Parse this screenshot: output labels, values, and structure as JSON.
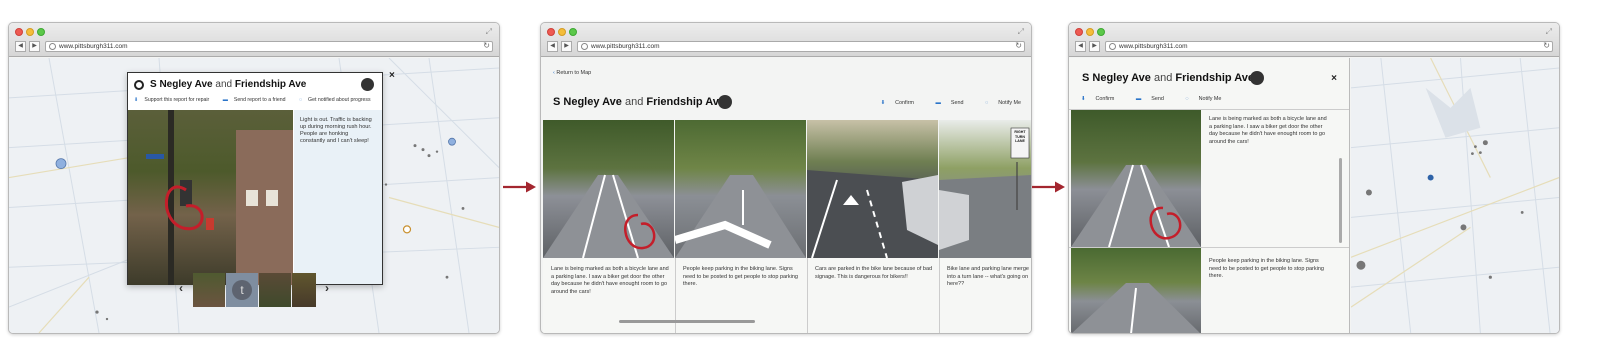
{
  "browser": {
    "url": "www.pittsburgh311.com"
  },
  "report": {
    "street1": "S Negley Ave",
    "conj": "and",
    "street2": "Friendship Ave"
  },
  "window1": {
    "actions": {
      "support": "Support this report for repair",
      "send": "Send report to a friend",
      "notify": "Get notified about progress"
    },
    "description": "Light is out. Traffic is backing up during morning rush hour. People are honking constantly and I can't sleep!",
    "close": "×",
    "carousel": {
      "prev": "‹",
      "next": "›",
      "twitter": "t"
    }
  },
  "window2": {
    "back": "Return to Map",
    "actions": {
      "confirm": "Confirm",
      "send": "Send",
      "notify": "Notify Me"
    },
    "photo_sign": "RIGHT TURN LANE",
    "texts": [
      "Lane is being marked as both a bicycle lane and a parking lane. I saw a biker get door the other day because he didn't have enought room to go around the cars!",
      "People keep parking in the biking lane. Signs need to be posted to get people to stop parking there.",
      "Cars are parked in the bike lane because of bad signage. This is dangerous for bikers!!",
      "Bike lane and parking lane merge into a turn lane -- what's going on here??"
    ]
  },
  "window3": {
    "actions": {
      "confirm": "Confirm",
      "send": "Send",
      "notify": "Notify Me"
    },
    "close": "×",
    "texts": [
      "Lane is being marked as both a bicycle lane and a parking lane. I saw a biker get door the other day because he didn't have enought room to go around the cars!",
      "People keep parking in the biking lane. Signs need to be posted to get people to stop parking there."
    ]
  },
  "colors": {
    "accent_red": "#a3262f",
    "action_blue": "#2a74c9",
    "marker_blue": "#8fb0df",
    "marker_gray": "#777777",
    "marker_orange": "#c8902f"
  }
}
